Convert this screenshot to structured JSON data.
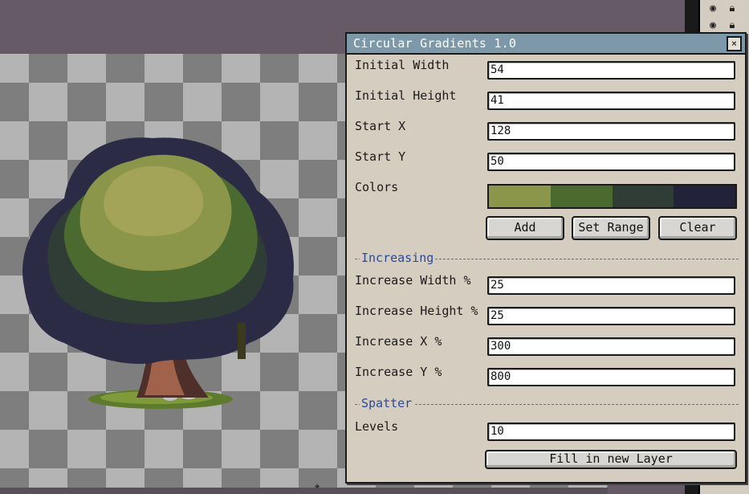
{
  "dialog": {
    "title": "Circular Gradients 1.0",
    "close_label": "×",
    "fields": [
      {
        "label": "Initial Width",
        "value": "54"
      },
      {
        "label": "Initial Height",
        "value": "41"
      },
      {
        "label": "Start X",
        "value": "128"
      },
      {
        "label": "Start Y",
        "value": "50"
      }
    ],
    "colors_label": "Colors",
    "color_swatches": [
      "#8b964b",
      "#4a6a30",
      "#2f3d36",
      "#22223a"
    ],
    "buttons": {
      "add": "Add",
      "set_range": "Set Range",
      "clear": "Clear",
      "fill": "Fill in new Layer"
    },
    "section_increasing": "Increasing",
    "increasing_fields": [
      {
        "label": "Increase Width %",
        "value": "25"
      },
      {
        "label": "Increase Height %",
        "value": "25"
      },
      {
        "label": "Increase X %",
        "value": "300"
      },
      {
        "label": "Increase Y %",
        "value": "800"
      }
    ],
    "section_spatter": "Spatter",
    "levels": {
      "label": "Levels",
      "value": "10"
    }
  },
  "icons": {
    "layer_visibility": "eye-icon",
    "layer_lock": "lock-icon",
    "close": "close-icon",
    "cursor": "crosshair-icon"
  },
  "colors": {
    "titlebar": "#7d98a8",
    "dialog_bg": "#d5cdc0",
    "section_text": "#2b4a9a",
    "workspace_bg": "#665a67"
  }
}
